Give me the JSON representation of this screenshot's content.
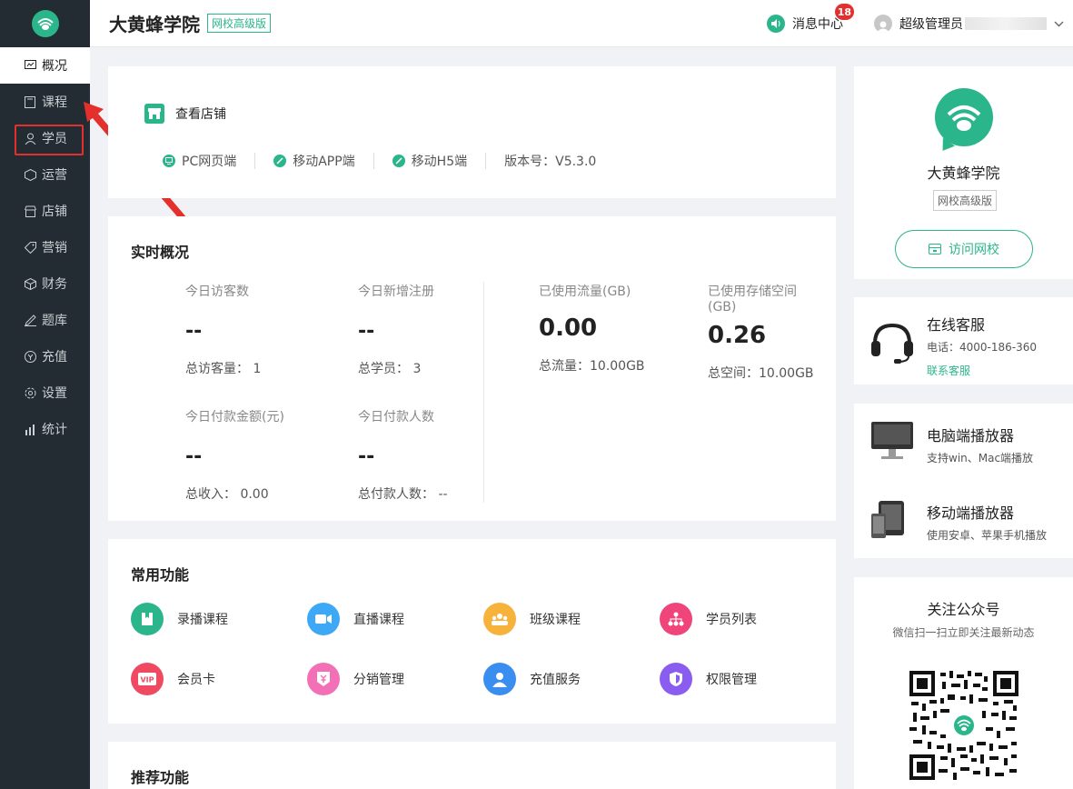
{
  "sidebar": {
    "items": [
      {
        "label": "概况",
        "icon": "dashboard-icon"
      },
      {
        "label": "课程",
        "icon": "book-icon"
      },
      {
        "label": "学员",
        "icon": "user-icon"
      },
      {
        "label": "运营",
        "icon": "cube-icon"
      },
      {
        "label": "店铺",
        "icon": "store-icon"
      },
      {
        "label": "营销",
        "icon": "tag-icon"
      },
      {
        "label": "财务",
        "icon": "box-icon"
      },
      {
        "label": "题库",
        "icon": "pen-icon"
      },
      {
        "label": "充值",
        "icon": "coin-icon"
      },
      {
        "label": "设置",
        "icon": "gear-icon"
      },
      {
        "label": "统计",
        "icon": "bar-chart-icon"
      }
    ]
  },
  "header": {
    "title": "大黄蜂学院",
    "tag": "网校高级版",
    "messages_label": "消息中心",
    "messages_count": "18",
    "user_name": "超级管理员"
  },
  "store": {
    "view_label": "查看店铺",
    "links": [
      "PC网页端",
      "移动APP端",
      "移动H5端"
    ],
    "version": "版本号：V5.3.0"
  },
  "realtime": {
    "title": "实时概况",
    "stats": [
      {
        "label": "今日访客数",
        "value": "--",
        "total": "总访客量：  1"
      },
      {
        "label": "今日新增注册",
        "value": "--",
        "total": "总学员：  3"
      },
      {
        "label": "今日付款金额(元)",
        "value": "--",
        "total": "总收入：  0.00"
      },
      {
        "label": "今日付款人数",
        "value": "--",
        "total": "总付款人数：  --"
      }
    ],
    "usage": [
      {
        "label": "已使用流量(GB)",
        "value": "0.00",
        "total": "总流量：10.00GB"
      },
      {
        "label": "已使用存储空间(GB)",
        "value": "0.26",
        "total": "总空间：10.00GB"
      }
    ]
  },
  "common": {
    "title": "常用功能",
    "items": [
      {
        "label": "录播课程",
        "color": "#2bb58b"
      },
      {
        "label": "直播课程",
        "color": "#3da8f5"
      },
      {
        "label": "班级课程",
        "color": "#f7b23b"
      },
      {
        "label": "学员列表",
        "color": "#f0457a"
      },
      {
        "label": "会员卡",
        "color": "#f04a63"
      },
      {
        "label": "分销管理",
        "color": "#f36fb6"
      },
      {
        "label": "充值服务",
        "color": "#3a8ef0"
      },
      {
        "label": "权限管理",
        "color": "#8a5cf0"
      }
    ]
  },
  "recommended": {
    "title": "推荐功能"
  },
  "school": {
    "name": "大黄蜂学院",
    "tag": "网校高级版",
    "visit_label": "访问网校"
  },
  "service": {
    "title": "在线客服",
    "phone": "电话：4000-186-360",
    "contact": "联系客服"
  },
  "players": [
    {
      "title": "电脑端播放器",
      "desc": "支持win、Mac端播放"
    },
    {
      "title": "移动端播放器",
      "desc": "使用安卓、苹果手机播放"
    }
  ],
  "wechat": {
    "title": "关注公众号",
    "desc": "微信扫一扫立即关注最新动态"
  },
  "colors": {
    "accent": "#2bb58b",
    "sidebar": "#232c32",
    "alert": "#e4302c"
  }
}
